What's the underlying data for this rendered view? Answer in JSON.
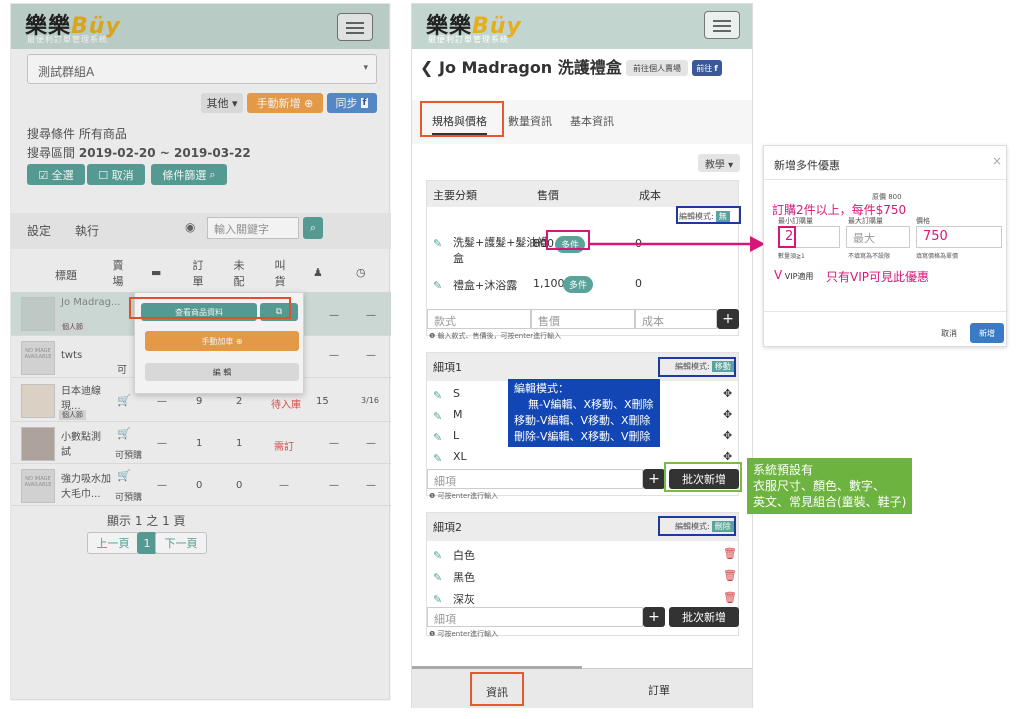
{
  "left": {
    "logo": "樂樂",
    "logo_b": "Büy",
    "logo_sub": "最便利訂單管理系統",
    "group_select": "測試群組A",
    "btn_other": "其他 ▾",
    "btn_manual_add": "手動新增 ⊕",
    "btn_sync": "同步",
    "search_cond": "搜尋條件 所有商品",
    "search_range_label": "搜尋區間",
    "search_range_value": "2019-02-20 ~ 2019-03-22",
    "btn_select_all": "☑ 全選",
    "btn_cancel": "☐ 取消",
    "btn_filter": "條件篩選",
    "tab_settings": "設定",
    "tab_execute": "執行",
    "keyword_placeholder": "輸入關鍵字",
    "col_title": "標題",
    "col_store": "賣場",
    "col_ordered": "訂單",
    "col_unshipped": "未配",
    "col_restock": "叫貨",
    "rows": [
      {
        "title": "Jo Madrag...",
        "tag": "個人節",
        "store": "",
        "c1": "—",
        "c2": "",
        "c3": "",
        "c4": "—",
        "c5": "",
        "c6": "—"
      },
      {
        "title": "twts",
        "tag": "",
        "store": "可",
        "c1": "",
        "c2": "",
        "c3": "",
        "c4": "理",
        "c5": "—",
        "c6": "—"
      },
      {
        "title": "日本迪線現...",
        "tag": "個人節",
        "store": "",
        "c1": "—",
        "c2": "9",
        "c3": "2",
        "c4": "待入庫",
        "c5": "15",
        "c6": "3/16"
      },
      {
        "title": "小數點測試",
        "tag": "",
        "store": "可預購",
        "c1": "—",
        "c2": "1",
        "c3": "1",
        "c4": "需訂",
        "c5": "—",
        "c6": "—"
      },
      {
        "title": "強力吸水加大毛巾...",
        "tag": "",
        "store": "可預購",
        "c1": "—",
        "c2": "0",
        "c3": "0",
        "c4": "—",
        "c5": "—",
        "c6": "—"
      }
    ],
    "no_image": "NO IMAGE AVAILABLE",
    "popup_view": "查看商品資料",
    "popup_add_cart": "手動加車 ⊕",
    "popup_edit": "編 輯",
    "pagination_info": "顯示 1 之 1 頁",
    "prev": "上一頁",
    "page": "1",
    "next": "下一頁"
  },
  "mid": {
    "product_title": "Jo Madragon 洗護禮盒",
    "btn_goto_store": "前往個人賣場",
    "btn_goto_fb": "前往",
    "tab_spec": "規格與價格",
    "tab_qty": "數量資訊",
    "tab_basic": "基本資訊",
    "btn_tutorial": "教學 ▾",
    "main_cat": "主要分類",
    "price": "售價",
    "cost": "成本",
    "edit_mode": "編輯模式:",
    "mode_none": "無",
    "item1_name": "洗髮+護髮+髮油禮盒",
    "item1_price": "800",
    "item1_cost": "0",
    "item2_name": "禮盒+沐浴露",
    "item2_price": "1,100",
    "item2_cost": "0",
    "multi_pill": "多件",
    "ph_style": "款式",
    "ph_price": "售價",
    "ph_cost": "成本",
    "note1": "❶ 輸入款式、售價後，可按enter進行輸入",
    "detail1": "細項1",
    "mode_move": "移動",
    "sizes": [
      "S",
      "M",
      "L",
      "XL"
    ],
    "ph_item": "細項",
    "btn_batch_add": "批次新增",
    "note2": "❶ 可按enter進行輸入",
    "detail2": "細項2",
    "mode_delete": "刪除",
    "colors": [
      "白色",
      "黑色",
      "深灰"
    ],
    "footer_info": "資訊",
    "footer_order": "訂單",
    "blue_note": "編輯模式：\n    無-V編輯、X移動、X刪除\n移動-V編輯、V移動、X刪除\n刪除-V編輯、X移動、V刪除",
    "green_note": "系統預設有\n衣服尺寸、顏色、數字、\n英文、常見組合(童裝、鞋子)"
  },
  "modal": {
    "title": "新增多件優惠",
    "close": "×",
    "orig_price": "原價 800",
    "annotation": "訂購2件以上，每件$750",
    "label_min": "最小訂購量",
    "label_max": "最大訂購量",
    "label_price": "價格",
    "val_min": "2",
    "ph_max": "最大",
    "val_price": "750",
    "hint_min": "數量須≧1",
    "hint_max": "不填寫為不設限",
    "hint_price": "填寫價格為單價",
    "vip_label": "VIP適用",
    "vip_note": "只有VIP可見此優惠",
    "btn_cancel": "取消",
    "btn_add": "新增"
  },
  "colors": {
    "teal": "#5aa39a",
    "orange": "#f0a24a",
    "header": "#c2d6cf",
    "red_highlight": "#e8582e",
    "blue_highlight": "#1e3aa0",
    "magenta": "#d8167a",
    "green": "#6cb33f"
  }
}
